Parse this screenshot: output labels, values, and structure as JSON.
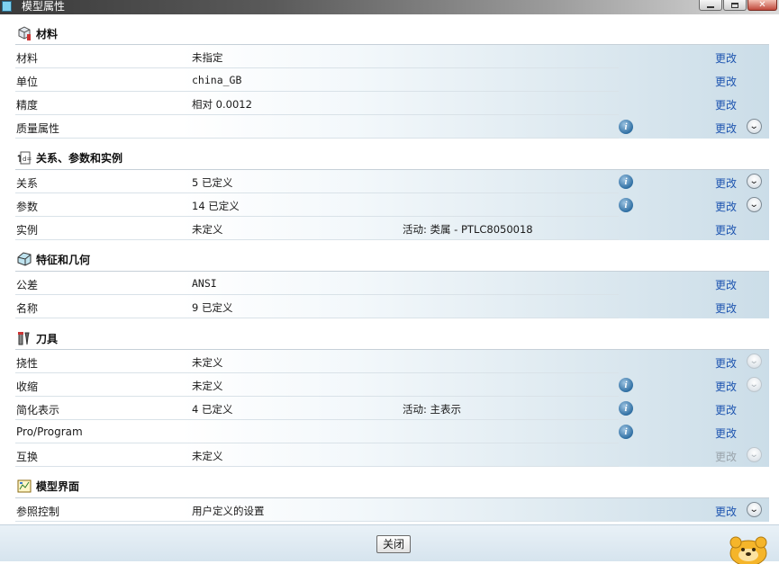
{
  "window": {
    "title": "模型属性",
    "controls": {
      "min_icon": "minimize-icon",
      "max_icon": "maximize-icon",
      "close_icon": "close-icon"
    }
  },
  "sections": [
    {
      "title": "材料",
      "icon": "material-icon",
      "rows": [
        {
          "label": "材料",
          "value": "未指定",
          "extra": "",
          "info": false,
          "change": "更改",
          "change_enabled": true,
          "expand": "none"
        },
        {
          "label": "单位",
          "value": "china_GB",
          "extra": "",
          "info": false,
          "change": "更改",
          "change_enabled": true,
          "expand": "none"
        },
        {
          "label": "精度",
          "value": "相对 0.0012",
          "extra": "",
          "info": false,
          "change": "更改",
          "change_enabled": true,
          "expand": "none"
        },
        {
          "label": "质量属性",
          "value": "",
          "extra": "",
          "info": true,
          "change": "更改",
          "change_enabled": true,
          "expand": "enabled"
        }
      ]
    },
    {
      "title": "关系、参数和实例",
      "icon": "relations-icon",
      "rows": [
        {
          "label": "关系",
          "value": "5 已定义",
          "extra": "",
          "info": true,
          "change": "更改",
          "change_enabled": true,
          "expand": "enabled"
        },
        {
          "label": "参数",
          "value": "14 已定义",
          "extra": "",
          "info": true,
          "change": "更改",
          "change_enabled": true,
          "expand": "enabled"
        },
        {
          "label": "实例",
          "value": "未定义",
          "extra": "活动: 类属 - PTLC8050018",
          "info": false,
          "change": "更改",
          "change_enabled": true,
          "expand": "none"
        }
      ]
    },
    {
      "title": "特征和几何",
      "icon": "features-icon",
      "rows": [
        {
          "label": "公差",
          "value": "ANSI",
          "extra": "",
          "info": false,
          "change": "更改",
          "change_enabled": true,
          "expand": "none"
        },
        {
          "label": "名称",
          "value": "9 已定义",
          "extra": "",
          "info": false,
          "change": "更改",
          "change_enabled": true,
          "expand": "none"
        }
      ]
    },
    {
      "title": "刀具",
      "icon": "tools-icon",
      "rows": [
        {
          "label": "挠性",
          "value": "未定义",
          "extra": "",
          "info": false,
          "change": "更改",
          "change_enabled": true,
          "expand": "disabled"
        },
        {
          "label": "收缩",
          "value": "未定义",
          "extra": "",
          "info": true,
          "change": "更改",
          "change_enabled": true,
          "expand": "disabled"
        },
        {
          "label": "简化表示",
          "value": "4 已定义",
          "extra": "活动: 主表示",
          "info": true,
          "change": "更改",
          "change_enabled": true,
          "expand": "none"
        },
        {
          "label": "Pro/Program",
          "value": "",
          "extra": "",
          "info": true,
          "change": "更改",
          "change_enabled": true,
          "expand": "none"
        },
        {
          "label": "互换",
          "value": "未定义",
          "extra": "",
          "info": false,
          "change": "更改",
          "change_enabled": false,
          "expand": "disabled"
        }
      ]
    },
    {
      "title": "模型界面",
      "icon": "model-interface-icon",
      "rows": [
        {
          "label": "参照控制",
          "value": "用户定义的设置",
          "extra": "",
          "info": false,
          "change": "更改",
          "change_enabled": true,
          "expand": "enabled"
        }
      ]
    }
  ],
  "footer": {
    "close_label": "关闭",
    "mascot": "mascot-icon"
  }
}
